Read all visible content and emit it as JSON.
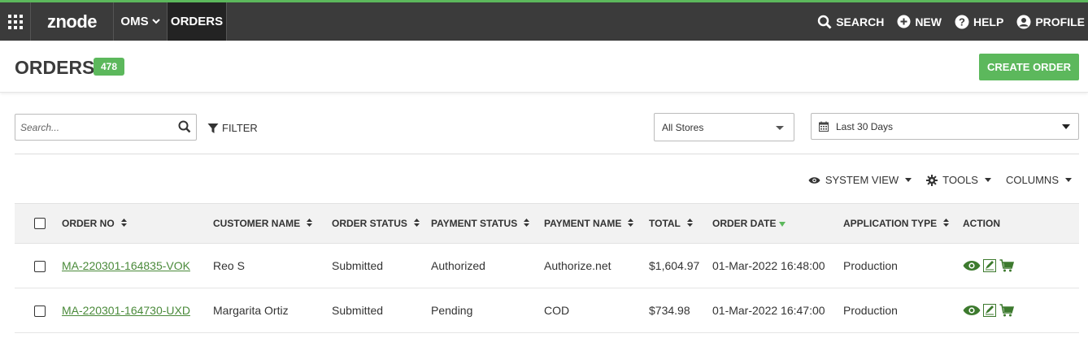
{
  "topbar": {
    "logo": "znode",
    "nav_oms": "OMS",
    "nav_orders": "ORDERS",
    "search": "SEARCH",
    "new": "NEW",
    "help": "HELP",
    "profile": "PROFILE"
  },
  "header": {
    "title": "ORDERS",
    "count": "478",
    "create_label": "CREATE ORDER"
  },
  "filters": {
    "search_placeholder": "Search...",
    "filter_label": "FILTER",
    "store_value": "All Stores",
    "date_value": "Last 30 Days"
  },
  "toolbar": {
    "system_view": "SYSTEM VIEW",
    "tools": "TOOLS",
    "columns": "COLUMNS"
  },
  "table": {
    "columns": [
      "ORDER NO",
      "CUSTOMER NAME",
      "ORDER STATUS",
      "PAYMENT STATUS",
      "PAYMENT NAME",
      "TOTAL",
      "ORDER DATE",
      "APPLICATION TYPE",
      "ACTION"
    ],
    "rows": [
      {
        "order_no": "MA-220301-164835-VOK",
        "customer": "Reo S",
        "order_status": "Submitted",
        "payment_status": "Authorized",
        "payment_name": "Authorize.net",
        "total": "$1,604.97",
        "order_date": "01-Mar-2022 16:48:00",
        "app_type": "Production"
      },
      {
        "order_no": "MA-220301-164730-UXD",
        "customer": "Margarita Ortiz",
        "order_status": "Submitted",
        "payment_status": "Pending",
        "payment_name": "COD",
        "total": "$734.98",
        "order_date": "01-Mar-2022 16:47:00",
        "app_type": "Production"
      }
    ]
  },
  "colors": {
    "accent_green": "#5cb85c",
    "topbar_bg": "#3b3b3b",
    "link_green": "#4a8a3a"
  },
  "icons": [
    "apps-grid-icon",
    "chevron-down-icon",
    "search-icon",
    "plus-circle-icon",
    "help-circle-icon",
    "user-circle-icon",
    "filter-icon",
    "calendar-icon",
    "eye-icon",
    "gear-icon",
    "sort-icon",
    "edit-note-icon",
    "cart-icon"
  ]
}
